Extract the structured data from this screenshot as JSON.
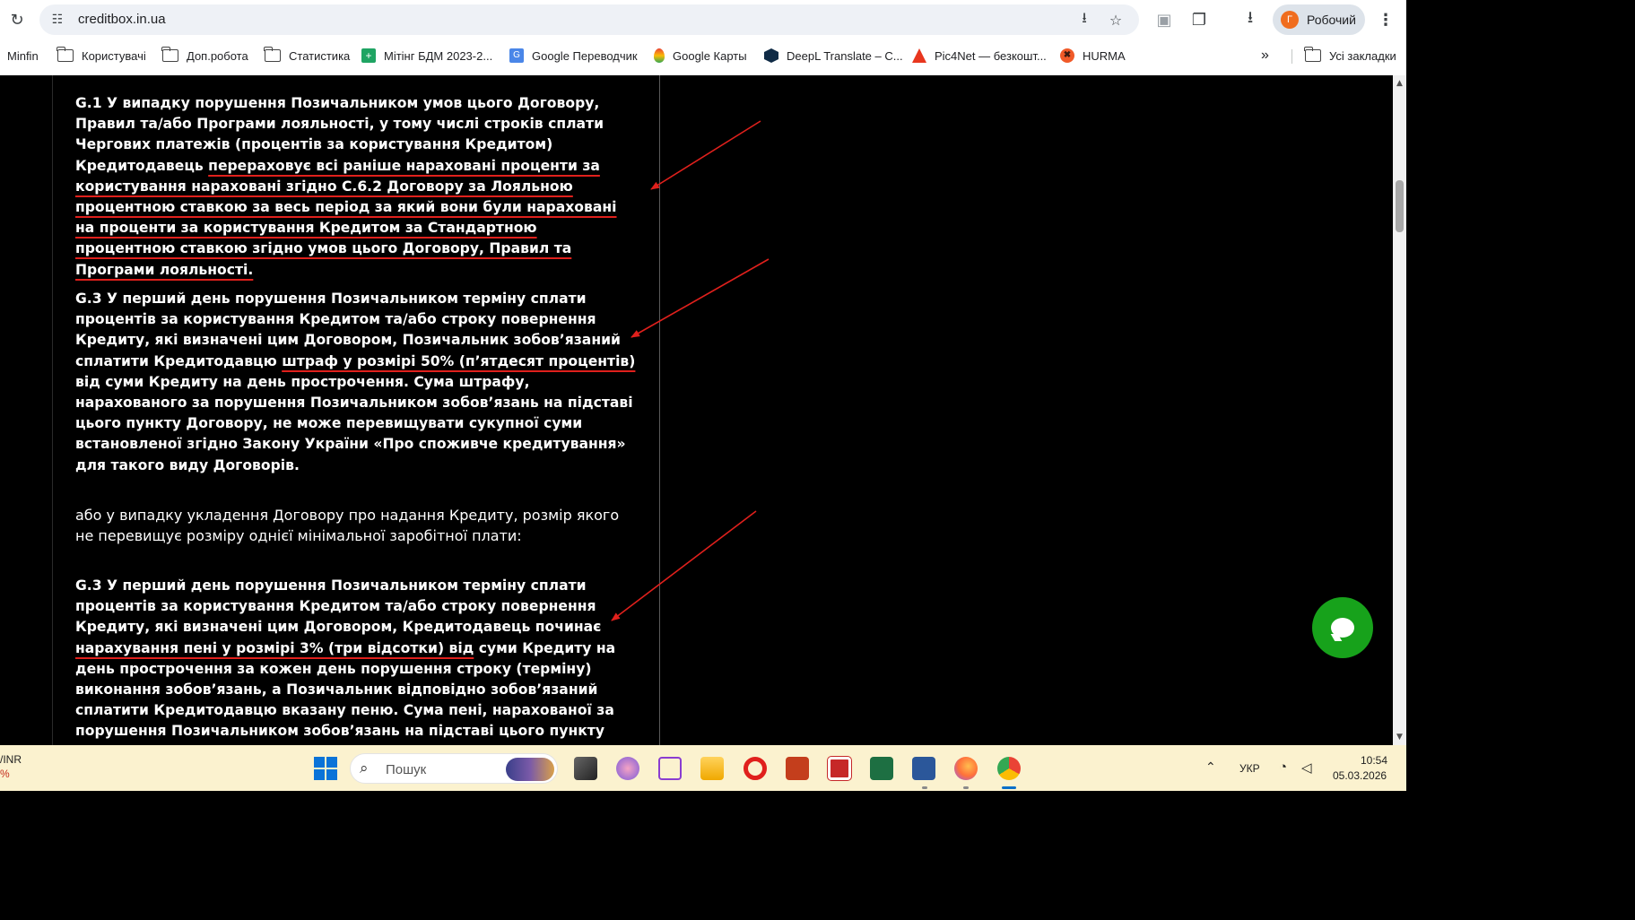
{
  "browser": {
    "url": "creditbox.in.ua",
    "profile_initial": "Г",
    "profile_name": "Робочий",
    "bookmarks": [
      {
        "label": "Minfin",
        "icon": "none"
      },
      {
        "label": "Користувачі",
        "icon": "folder-icon"
      },
      {
        "label": "Доп.робота",
        "icon": "folder-icon"
      },
      {
        "label": "Статистика",
        "icon": "folder-icon"
      },
      {
        "label": "Мітінг БДМ 2023-2...",
        "icon": "sheets-icon"
      },
      {
        "label": "Google Переводчик",
        "icon": "translate-icon"
      },
      {
        "label": "Google Карты",
        "icon": "maps-icon"
      },
      {
        "label": "DeepL Translate – С...",
        "icon": "deepl-icon"
      },
      {
        "label": "Pic4Net — безкошт...",
        "icon": "pic4net-icon"
      },
      {
        "label": "HURMA",
        "icon": "hurma-icon"
      }
    ],
    "overflow_label": "»",
    "all_bookmarks": "Усі закладки"
  },
  "content": {
    "p1_before": "G.1 У випадку порушення Позичальником умов цього Договору, Правил та/або Програми лояльності, у тому числі строків сплати Чергових платежів (процентів за користування Кредитом) Кредитодавець ",
    "p1_underlined": "перераховує всі раніше нараховані проценти за користування нараховані згідно С.6.2 Договору за Лояльною процентною ставкою за весь період за який вони були нараховані на проценти за користування Кредитом за Стандартною процентною ставкою згідно умов цього Договору, Правил та Програми лояльності.",
    "p2_before": "G.3 У перший день порушення Позичальником терміну сплати процентів за користування Кредитом та/або строку повернення Кредиту, які визначені цим Договором, Позичальник зобов’язаний сплатити Кредитодавцю ",
    "p2_underlined": "штраф у розмірі 50% (п’ятдесят процентів)",
    "p2_after": " від суми Кредиту на день прострочення. Сума штрафу, нарахованого за порушення Позичальником зобов’язань на підставі цього пункту Договору, не може перевищувати сукупної суми встановленої згідно Закону України «Про споживче кредитування» для такого виду Договорів.",
    "p3": "або у випадку укладення Договору про надання Кредиту, розмір якого не перевищує розміру однієї мінімальної заробітної плати:",
    "p4_before": "G.3 У перший день порушення Позичальником терміну сплати процентів за користування Кредитом та/або строку повернення Кредиту, які визначені цим Договором, Кредитодавець починає ",
    "p4_underlined": "нарахування пені у розмірі 3% (три відсотки) від",
    "p4_after": " суми Кредиту на день прострочення за кожен день порушення строку (терміну) виконання зобов’язань, а Позичальник відповідно зобов’язаний сплатити Кредитодавцю вказану пеню. Сума пені, нарахованої за порушення Позичальником зобов’язань на підставі цього пункту Договору, не"
  },
  "taskbar": {
    "widget_line1": "/INR",
    "widget_line2": "%",
    "search_placeholder": "Пошук",
    "language": "УКР",
    "time": "10:54",
    "date": "05.03.2026"
  },
  "colors": {
    "annotation_red": "#e0201c",
    "chat_green": "#17a21b"
  }
}
